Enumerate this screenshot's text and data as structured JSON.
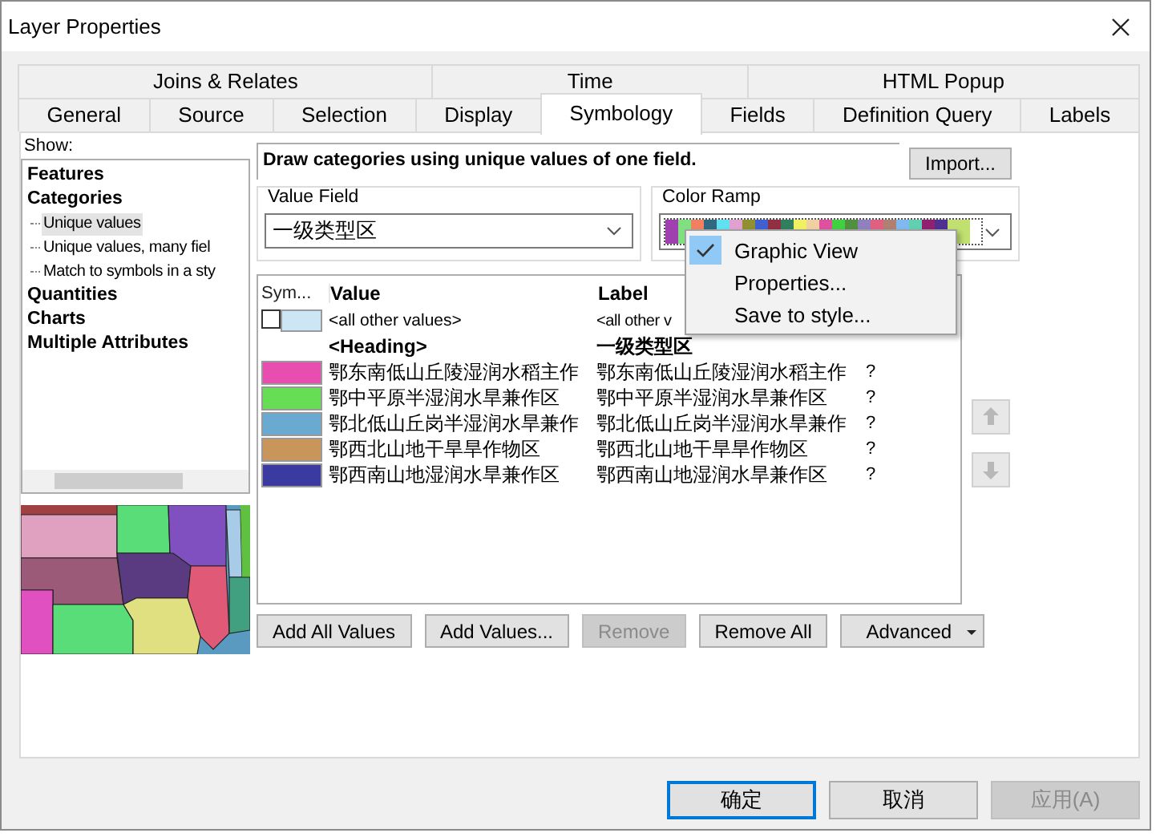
{
  "window": {
    "title": "Layer Properties"
  },
  "tab_rows": [
    [
      {
        "label": "Joins & Relates",
        "selected": false
      },
      {
        "label": "Time",
        "selected": false
      },
      {
        "label": "HTML Popup",
        "selected": false
      }
    ],
    [
      {
        "label": "General",
        "selected": false
      },
      {
        "label": "Source",
        "selected": false
      },
      {
        "label": "Selection",
        "selected": false
      },
      {
        "label": "Display",
        "selected": false
      },
      {
        "label": "Symbology",
        "selected": true
      },
      {
        "label": "Fields",
        "selected": false
      },
      {
        "label": "Definition Query",
        "selected": false
      },
      {
        "label": "Labels",
        "selected": false
      }
    ]
  ],
  "show": {
    "label": "Show:",
    "tree": [
      {
        "label": "Features",
        "selected": false
      },
      {
        "label": "Categories",
        "selected": false,
        "children": [
          {
            "label": "Unique values",
            "selected": true
          },
          {
            "label": "Unique values, many fiel",
            "selected": false
          },
          {
            "label": "Match to symbols in a sty",
            "selected": false
          }
        ]
      },
      {
        "label": "Quantities",
        "selected": false
      },
      {
        "label": "Charts",
        "selected": false
      },
      {
        "label": "Multiple Attributes",
        "selected": false
      }
    ]
  },
  "description": "Draw categories using unique values of one field.",
  "import_button": "Import...",
  "value_field": {
    "label": "Value Field",
    "value": "一级类型区"
  },
  "color_ramp": {
    "label": "Color Ramp"
  },
  "context_menu": [
    {
      "label": "Graphic View",
      "checked": true
    },
    {
      "label": "Properties...",
      "checked": false
    },
    {
      "label": "Save to style...",
      "checked": false
    }
  ],
  "legend": {
    "columns": [
      "Sym...",
      "Value",
      "Label"
    ],
    "rows": [
      {
        "kind": "other",
        "checked": false,
        "color": "#cce6f6",
        "value": "<all other values>",
        "label": "<all other v"
      },
      {
        "kind": "heading",
        "value": "<Heading>",
        "label": "一级类型区"
      },
      {
        "kind": "class",
        "color": "#e84db0",
        "value": "鄂东南低山丘陵湿润水稻主作",
        "label": "鄂东南低山丘陵湿润水稻主作",
        "count": "?"
      },
      {
        "kind": "class",
        "color": "#66dd55",
        "value": "鄂中平原半湿润水旱兼作区",
        "label": "鄂中平原半湿润水旱兼作区",
        "count": "?"
      },
      {
        "kind": "class",
        "color": "#6aaad0",
        "value": "鄂北低山丘岗半湿润水旱兼作",
        "label": "鄂北低山丘岗半湿润水旱兼作",
        "count": "?"
      },
      {
        "kind": "class",
        "color": "#c8965a",
        "value": "鄂西北山地干旱旱作物区",
        "label": "鄂西北山地干旱旱作物区",
        "count": "?"
      },
      {
        "kind": "class",
        "color": "#3a3aa0",
        "value": "鄂西南山地湿润水旱兼作区",
        "label": "鄂西南山地湿润水旱兼作区",
        "count": "?"
      }
    ]
  },
  "legend_buttons": [
    {
      "label": "Add All Values",
      "disabled": false,
      "kind": "plain"
    },
    {
      "label": "Add Values...",
      "disabled": false,
      "kind": "plain"
    },
    {
      "label": "Remove",
      "disabled": true,
      "kind": "plain"
    },
    {
      "label": "Remove All",
      "disabled": false,
      "kind": "plain"
    },
    {
      "label": "Advanced",
      "disabled": false,
      "kind": "dropdown"
    }
  ],
  "dialog_buttons": [
    {
      "label": "确定",
      "default": true,
      "disabled": false
    },
    {
      "label": "取消",
      "default": false,
      "disabled": false
    },
    {
      "label": "应用(A)",
      "default": false,
      "disabled": true
    }
  ]
}
